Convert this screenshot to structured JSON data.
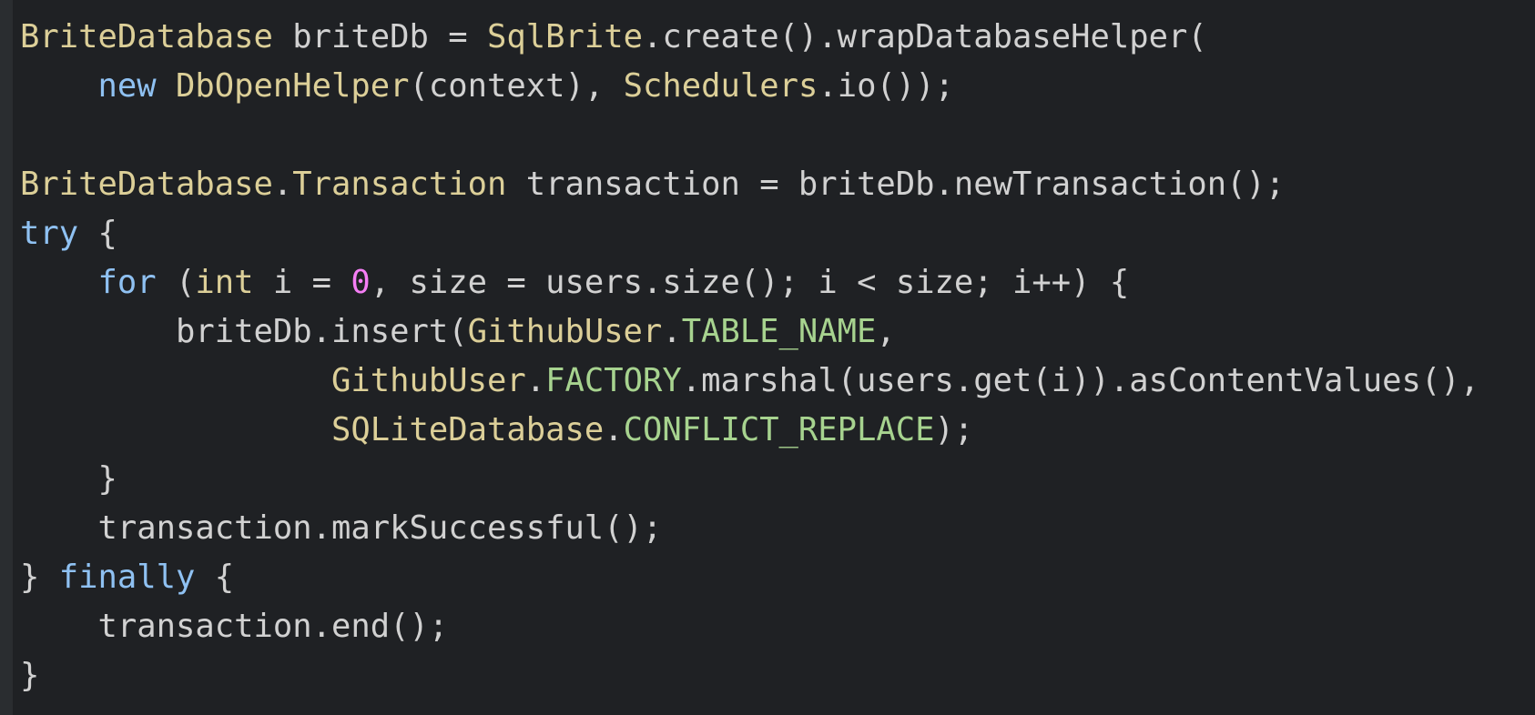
{
  "editor": {
    "lines": [
      [
        {
          "t": "type",
          "s": "BriteDatabase"
        },
        {
          "t": "plain",
          "s": " briteDb = "
        },
        {
          "t": "type",
          "s": "SqlBrite"
        },
        {
          "t": "plain",
          "s": ".create().wrapDatabaseHelper("
        }
      ],
      [
        {
          "t": "plain",
          "s": "    "
        },
        {
          "t": "kw",
          "s": "new"
        },
        {
          "t": "plain",
          "s": " "
        },
        {
          "t": "type",
          "s": "DbOpenHelper"
        },
        {
          "t": "plain",
          "s": "(context), "
        },
        {
          "t": "type",
          "s": "Schedulers"
        },
        {
          "t": "plain",
          "s": ".io());"
        }
      ],
      [],
      [
        {
          "t": "type",
          "s": "BriteDatabase"
        },
        {
          "t": "plain",
          "s": "."
        },
        {
          "t": "type",
          "s": "Transaction"
        },
        {
          "t": "plain",
          "s": " transaction = briteDb.newTransaction();"
        }
      ],
      [
        {
          "t": "kw",
          "s": "try"
        },
        {
          "t": "plain",
          "s": " {"
        }
      ],
      [
        {
          "t": "plain",
          "s": "    "
        },
        {
          "t": "kw",
          "s": "for"
        },
        {
          "t": "plain",
          "s": " ("
        },
        {
          "t": "type",
          "s": "int"
        },
        {
          "t": "plain",
          "s": " i = "
        },
        {
          "t": "num",
          "s": "0"
        },
        {
          "t": "plain",
          "s": ", size = users.size(); i < size; i++) {"
        }
      ],
      [
        {
          "t": "plain",
          "s": "        briteDb.insert("
        },
        {
          "t": "type",
          "s": "GithubUser"
        },
        {
          "t": "plain",
          "s": "."
        },
        {
          "t": "const",
          "s": "TABLE_NAME"
        },
        {
          "t": "plain",
          "s": ","
        }
      ],
      [
        {
          "t": "plain",
          "s": "                "
        },
        {
          "t": "type",
          "s": "GithubUser"
        },
        {
          "t": "plain",
          "s": "."
        },
        {
          "t": "const",
          "s": "FACTORY"
        },
        {
          "t": "plain",
          "s": ".marshal(users.get(i)).asContentValues(),"
        }
      ],
      [
        {
          "t": "plain",
          "s": "                "
        },
        {
          "t": "type",
          "s": "SQLiteDatabase"
        },
        {
          "t": "plain",
          "s": "."
        },
        {
          "t": "const",
          "s": "CONFLICT_REPLACE"
        },
        {
          "t": "plain",
          "s": ");"
        }
      ],
      [
        {
          "t": "plain",
          "s": "    }"
        }
      ],
      [
        {
          "t": "plain",
          "s": "    transaction.markSuccessful();"
        }
      ],
      [
        {
          "t": "plain",
          "s": "} "
        },
        {
          "t": "kw",
          "s": "finally"
        },
        {
          "t": "plain",
          "s": " {"
        }
      ],
      [
        {
          "t": "plain",
          "s": "    transaction.end();"
        }
      ],
      [
        {
          "t": "plain",
          "s": "}"
        }
      ]
    ]
  },
  "colors": {
    "background": "#1f2124",
    "keyword": "#8fc1f2",
    "type": "#dccf98",
    "constant": "#a7d38f",
    "number": "#f57ef5",
    "plain": "#d1d1d1"
  }
}
